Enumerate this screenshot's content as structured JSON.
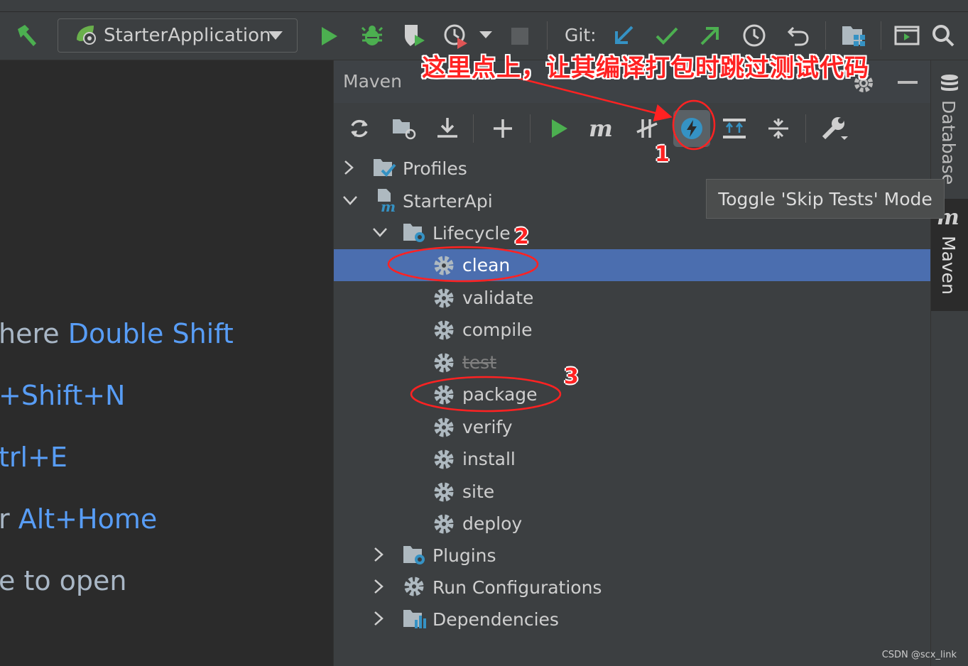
{
  "toolbar": {
    "run_config": "StarterApplication",
    "git_label": "Git:"
  },
  "editor_hints": [
    {
      "text": "here ",
      "key": "Double Shift"
    },
    {
      "text": "",
      "key": "+Shift+N"
    },
    {
      "text": "",
      "key": "trl+E"
    },
    {
      "text": "r ",
      "key": "Alt+Home"
    },
    {
      "text": "e to open",
      "key": ""
    }
  ],
  "maven": {
    "title": "Maven",
    "tree": {
      "profiles": "Profiles",
      "project": "StarterApi",
      "lifecycle": "Lifecycle",
      "goals": [
        "clean",
        "validate",
        "compile",
        "test",
        "package",
        "verify",
        "install",
        "site",
        "deploy"
      ],
      "plugins": "Plugins",
      "run_configurations": "Run Configurations",
      "dependencies": "Dependencies"
    },
    "tooltip": "Toggle 'Skip Tests' Mode"
  },
  "right_stripe": {
    "database": "Database",
    "maven": "Maven"
  },
  "annotation": {
    "note": "这里点上，让其编译打包时跳过测试代码",
    "n1": "1",
    "n2": "2",
    "n3": "3"
  },
  "watermark": "CSDN @scx_link",
  "colors": {
    "selection": "#4b6eaf",
    "annotation": "#ff2222",
    "shortcut": "#589df6",
    "run_green": "#4caf50"
  }
}
